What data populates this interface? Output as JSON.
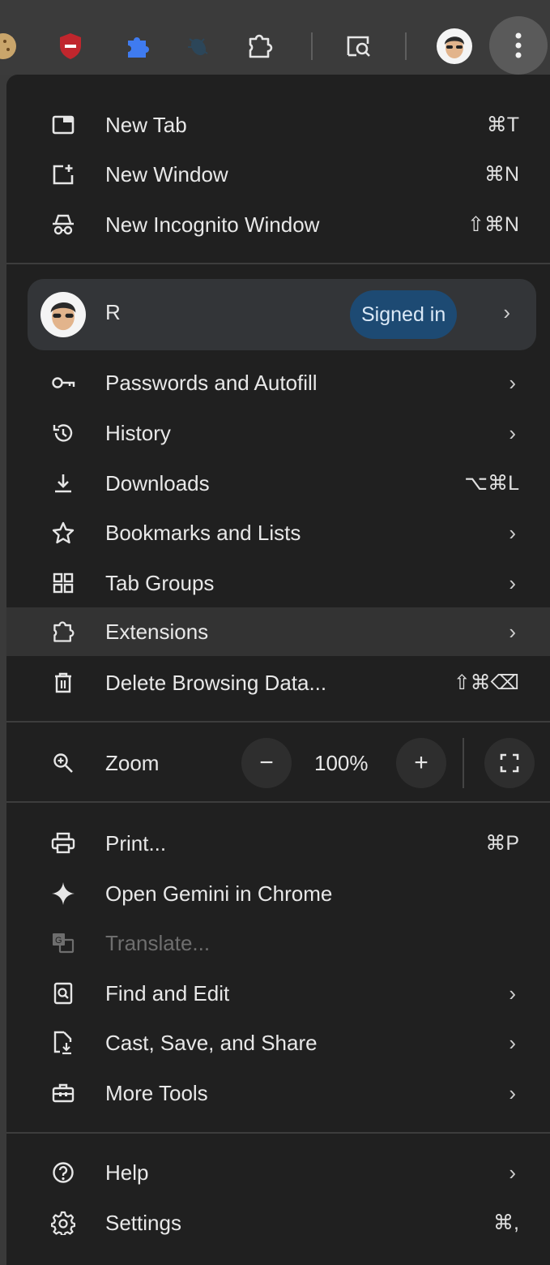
{
  "toolbar": {
    "icons": [
      "cookie-icon",
      "shield-icon",
      "puzzle-icon",
      "bug-icon",
      "extensions-icon",
      "search-tab-icon",
      "avatar",
      "more-vert-icon"
    ]
  },
  "menu": {
    "new_tab": {
      "label": "New Tab",
      "shortcut": "⌘T"
    },
    "new_window": {
      "label": "New Window",
      "shortcut": "⌘N"
    },
    "new_incognito": {
      "label": "New Incognito Window",
      "shortcut": "⇧⌘N"
    },
    "profile": {
      "name": "R",
      "status": "Signed in"
    },
    "passwords": {
      "label": "Passwords and Autofill"
    },
    "history": {
      "label": "History"
    },
    "downloads": {
      "label": "Downloads",
      "shortcut": "⌥⌘L"
    },
    "bookmarks": {
      "label": "Bookmarks and Lists"
    },
    "tab_groups": {
      "label": "Tab Groups"
    },
    "extensions": {
      "label": "Extensions"
    },
    "delete_data": {
      "label": "Delete Browsing Data...",
      "shortcut": "⇧⌘⌫"
    },
    "zoom": {
      "label": "Zoom",
      "value": "100%",
      "minus": "−",
      "plus": "+"
    },
    "print": {
      "label": "Print...",
      "shortcut": "⌘P"
    },
    "gemini": {
      "label": "Open Gemini in Chrome"
    },
    "translate": {
      "label": "Translate..."
    },
    "find_edit": {
      "label": "Find and Edit"
    },
    "cast_save": {
      "label": "Cast, Save, and Share"
    },
    "more_tools": {
      "label": "More Tools"
    },
    "help": {
      "label": "Help"
    },
    "settings": {
      "label": "Settings",
      "shortcut": "⌘,"
    }
  },
  "chevron": "›",
  "colors": {
    "menu_bg": "#202020",
    "badge_bg": "#1d4a73",
    "highlight": "#333333",
    "shield": "#c0262d",
    "puzzle_blue": "#3f7bf0"
  }
}
